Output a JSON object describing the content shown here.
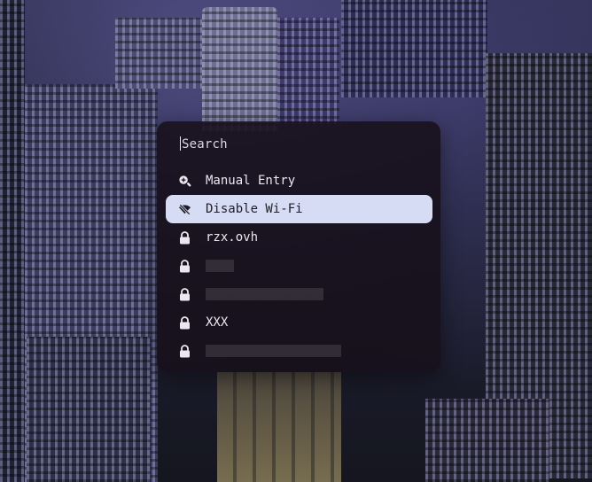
{
  "launcher": {
    "search_placeholder": "Search",
    "items": [
      {
        "label": "Manual Entry",
        "icon": "zoom-in-icon",
        "selected": false
      },
      {
        "label": "Disable Wi-Fi",
        "icon": "wifi-off-icon",
        "selected": true
      },
      {
        "label": "rzx.ovh",
        "icon": "lock-icon",
        "selected": false
      },
      {
        "label": "",
        "icon": "lock-icon",
        "selected": false,
        "redacted": true
      },
      {
        "label": "",
        "icon": "lock-icon",
        "selected": false,
        "redacted": true
      },
      {
        "label": "XXX",
        "icon": "lock-icon",
        "selected": false
      },
      {
        "label": "",
        "icon": "lock-icon",
        "selected": false,
        "redacted": true
      }
    ]
  },
  "colors": {
    "panel_bg": "#17111c",
    "selected_bg": "#d7dcf5",
    "text": "#e8e8ee"
  }
}
